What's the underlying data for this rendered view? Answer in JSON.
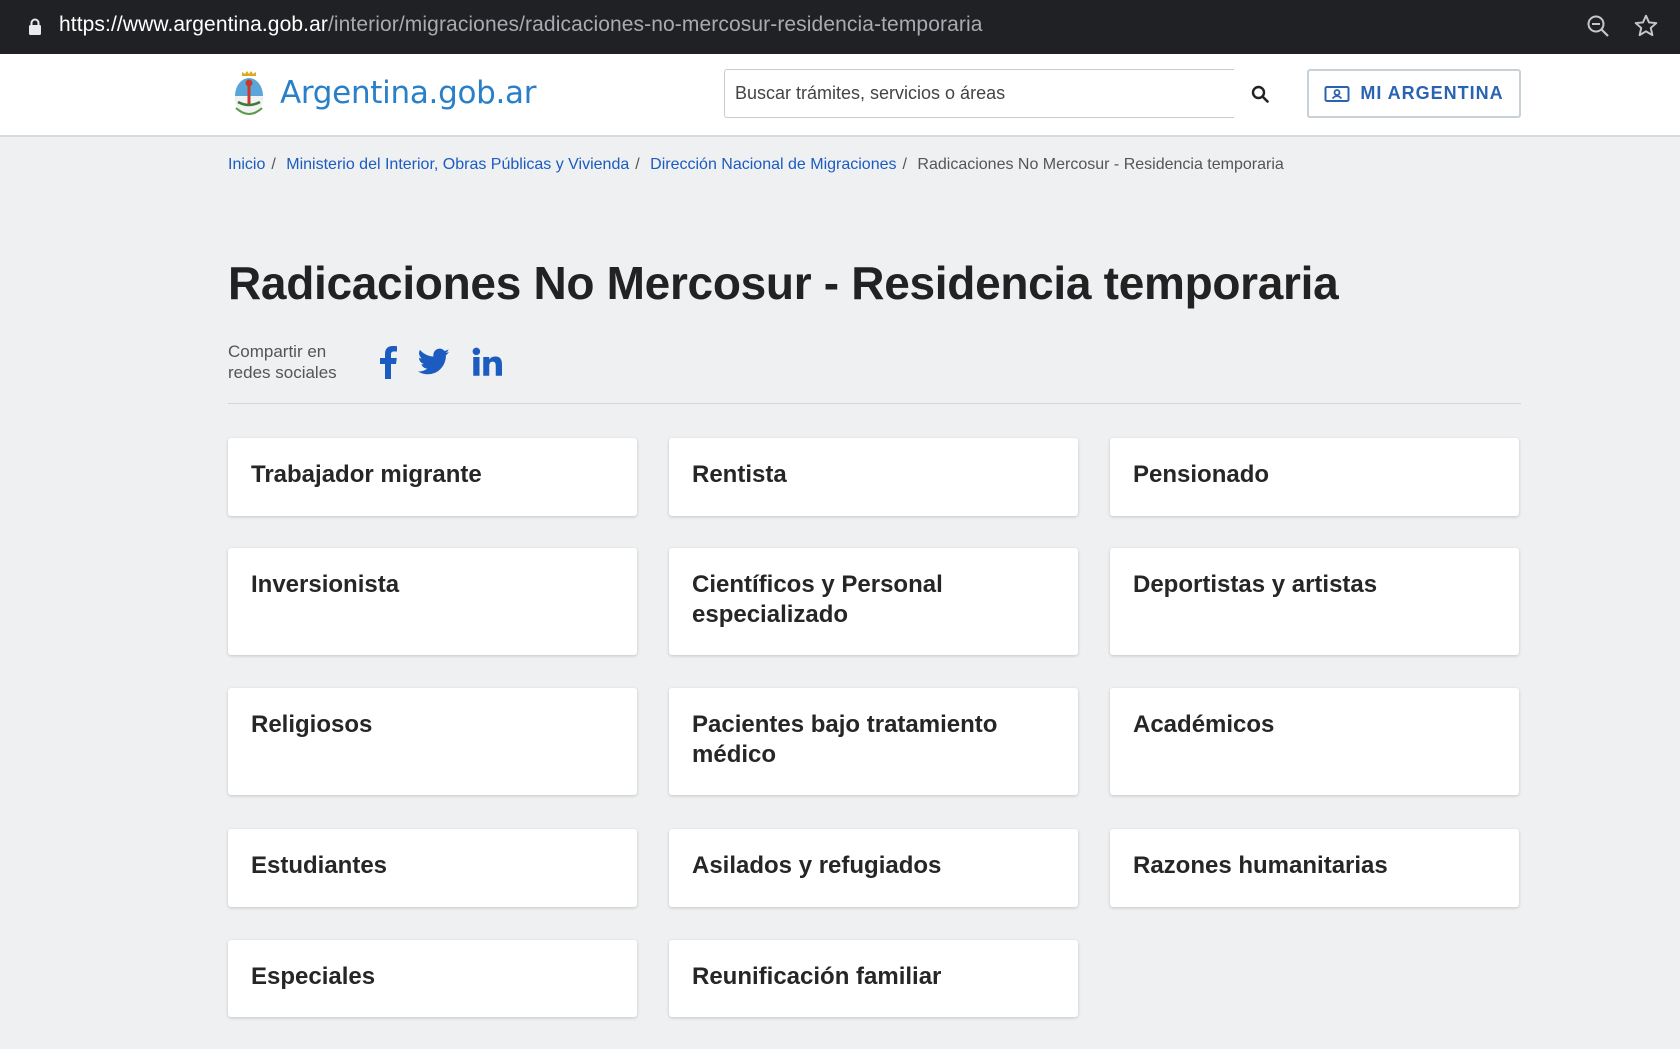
{
  "browser": {
    "url_host": "https://www.argentina.gob.ar",
    "url_path": "/interior/migraciones/radicaciones-no-mercosur-residencia-temporaria"
  },
  "header": {
    "brand": "Argentina.gob.ar",
    "search_placeholder": "Buscar trámites, servicios o áreas",
    "mi_argentina_label": "MI ARGENTINA"
  },
  "breadcrumb": {
    "items": [
      "Inicio",
      "Ministerio del Interior, Obras Públicas y Vivienda",
      "Dirección Nacional de Migraciones"
    ],
    "current": "Radicaciones No Mercosur - Residencia temporaria"
  },
  "page": {
    "title": "Radicaciones No Mercosur - Residencia temporaria",
    "share_label_line1": "Compartir en",
    "share_label_line2": "redes sociales"
  },
  "cards": [
    "Trabajador migrante",
    "Rentista",
    "Pensionado",
    "Inversionista",
    "Científicos y Personal especializado",
    "Deportistas y artistas",
    "Religiosos",
    "Pacientes bajo tratamiento médico",
    "Académicos",
    "Estudiantes",
    "Asilados y refugiados",
    "Razones humanitarias",
    "Especiales",
    "Reunificación familiar"
  ],
  "colors": {
    "link": "#1c5bbf",
    "brand": "#2a7fc9",
    "social": "#1c5bbf"
  },
  "icons": [
    "lock-icon",
    "zoom-out-icon",
    "bookmark-star-icon",
    "coat-of-arms-logo",
    "search-icon",
    "id-card-icon",
    "facebook-icon",
    "twitter-icon",
    "linkedin-icon"
  ]
}
